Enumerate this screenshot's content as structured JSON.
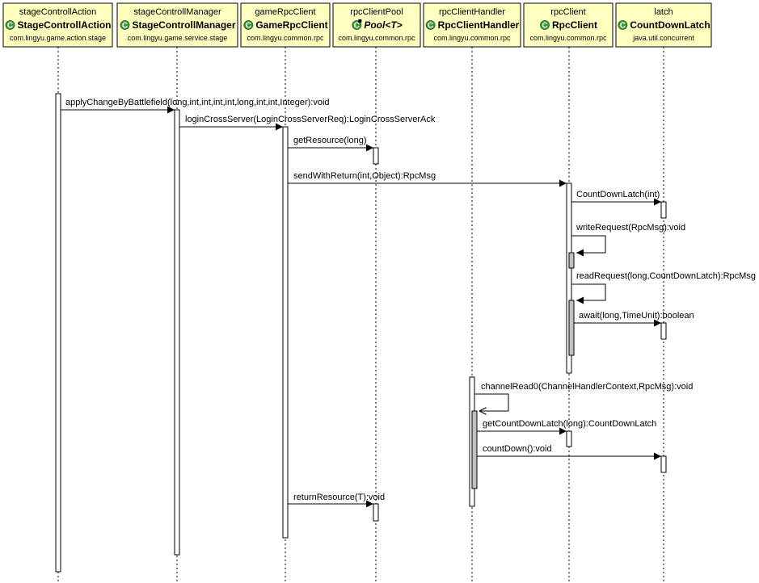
{
  "participants": [
    {
      "variable": "stageControllAction",
      "type": "StageControllAction",
      "package": "com.lingyu.game.action.stage",
      "icon": "class-icon",
      "italic": false
    },
    {
      "variable": "stageControllManager",
      "type": "StageControllManager",
      "package": "com.lingyu.game.service.stage",
      "icon": "class-icon",
      "italic": false
    },
    {
      "variable": "gameRpcClient",
      "type": "GameRpcClient",
      "package": "com.lingyu.common.rpc",
      "icon": "class-icon",
      "italic": false
    },
    {
      "variable": "rpcClientPool",
      "type": "Pool<T>",
      "package": "com.lingyu.common.rpc",
      "icon": "abstract-class-icon",
      "italic": true
    },
    {
      "variable": "rpcClientHandler",
      "type": "RpcClientHandler",
      "package": "com.lingyu.common.rpc",
      "icon": "class-icon",
      "italic": false
    },
    {
      "variable": "rpcClient",
      "type": "RpcClient",
      "package": "com.lingyu.common.rpc",
      "icon": "class-icon",
      "italic": false
    },
    {
      "variable": "latch",
      "type": "CountDownLatch",
      "package": "java.util.concurrent",
      "icon": "class-icon",
      "italic": false
    }
  ],
  "messages": [
    {
      "from": 0,
      "to": 1,
      "label": "applyChangeByBattlefield(long,int,int,int,int,long,int,int,Integer):void"
    },
    {
      "from": 1,
      "to": 2,
      "label": "loginCrossServer(LoginCrossServerReq):LoginCrossServerAck"
    },
    {
      "from": 2,
      "to": 3,
      "label": "getResource(long)"
    },
    {
      "from": 2,
      "to": 5,
      "label": "sendWithReturn(int,Object):RpcMsg"
    },
    {
      "from": 5,
      "to": 6,
      "label": "CountDownLatch(int)"
    },
    {
      "from": 5,
      "to": 5,
      "label": "writeRequest(RpcMsg):void"
    },
    {
      "from": 5,
      "to": 5,
      "label": "readRequest(long,CountDownLatch):RpcMsg"
    },
    {
      "from": 5,
      "to": 6,
      "label": "await(long,TimeUnit):boolean"
    },
    {
      "from": 4,
      "to": 4,
      "label": "channelRead0(ChannelHandlerContext,RpcMsg):void"
    },
    {
      "from": 4,
      "to": 5,
      "label": "getCountDownLatch(long):CountDownLatch"
    },
    {
      "from": 4,
      "to": 6,
      "label": "countDown():void"
    },
    {
      "from": 2,
      "to": 3,
      "label": "returnResource(T):void"
    }
  ],
  "colors": {
    "header_fill": "#ffffc0",
    "icon_green": "#3c9a3c",
    "nested_activation": "#c0c0c0"
  }
}
